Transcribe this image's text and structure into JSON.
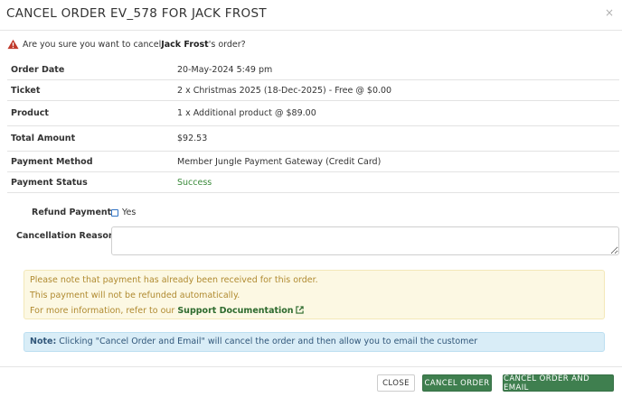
{
  "modal": {
    "title": "CANCEL ORDER EV_578 FOR JACK FROST",
    "close_symbol": "×"
  },
  "confirm": {
    "prefix": "Are you sure you want to cancel ",
    "name": "Jack Frost",
    "suffix": "'s order?",
    "icon": "warning-triangle-icon"
  },
  "details": [
    {
      "label": "Order Date",
      "value": "20-May-2024 5:49 pm"
    },
    {
      "label": "Ticket",
      "value": "2 x Christmas 2025 (18-Dec-2025) - Free @ $0.00"
    },
    {
      "label": "Product",
      "value": "1 x Additional product @ $89.00"
    },
    {
      "label": "Total Amount",
      "value": "$92.53"
    },
    {
      "label": "Payment Method",
      "value": "Member Jungle Payment Gateway (Credit Card)"
    },
    {
      "label": "Payment Status",
      "value": "Success"
    }
  ],
  "refund": {
    "label": "Refund Payment",
    "option": "Yes",
    "checked": false
  },
  "reason": {
    "label": "Cancellation Reason",
    "value": ""
  },
  "warning": {
    "line1": "Please note that payment has already been received for this order.",
    "line2": "This payment will not be refunded automatically.",
    "line3_prefix": "For more information, refer to our ",
    "link": "Support Documentation",
    "color": "#fcf8e3"
  },
  "note": {
    "label": "Note:",
    "text": " Clicking \"Cancel Order and Email\" will cancel the order and then allow you to email the customer",
    "color": "#d9edf7"
  },
  "buttons": {
    "close": "CLOSE",
    "cancel_order": "CANCEL ORDER",
    "cancel_order_email": "CANCEL ORDER AND EMAIL",
    "primary_color": "#3f7f4f"
  }
}
